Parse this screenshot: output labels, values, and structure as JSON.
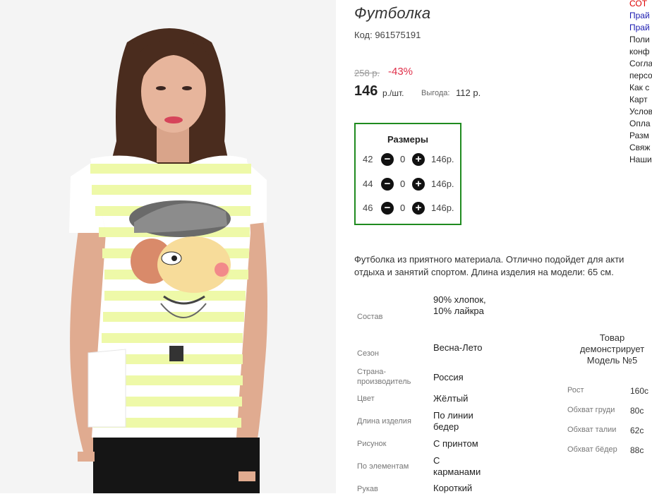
{
  "product": {
    "title": "Футболка",
    "code": "Код: 961575191",
    "old_price": "258 р.",
    "discount": "-43%",
    "price": "146",
    "price_unit": "р./шт.",
    "savings_label": "Выгода:",
    "savings_value": "112 р."
  },
  "sizes": {
    "title": "Размеры",
    "rows": [
      {
        "size": "42",
        "qty": "0",
        "price": "146р."
      },
      {
        "size": "44",
        "qty": "0",
        "price": "146р."
      },
      {
        "size": "46",
        "qty": "0",
        "price": "146р."
      }
    ]
  },
  "description": {
    "line1": "Футболка из приятного материала. Отлично подойдет для акти",
    "line2": "отдыха и занятий спортом. Длина изделия на модели: 65 см."
  },
  "attributes": [
    {
      "label": "Состав",
      "value": "90% хлопок, 10% лайкра"
    },
    {
      "label": "Сезон",
      "value": "Весна-Лето"
    },
    {
      "label": "Страна-производитель",
      "value": "Россия"
    },
    {
      "label": "Цвет",
      "value": "Жёлтый"
    },
    {
      "label": "Длина изделия",
      "value": "По линии бедер"
    },
    {
      "label": "Рисунок",
      "value": "С принтом"
    },
    {
      "label": "По элементам",
      "value": "С карманами"
    },
    {
      "label": "Рукав",
      "value": "Короткий"
    }
  ],
  "model": {
    "title": "Товар демонстрирует Модель №5",
    "measurements": [
      {
        "label": "Рост",
        "value": "160с"
      },
      {
        "label": "Обхват груди",
        "value": "80с"
      },
      {
        "label": "Обхват талии",
        "value": "62с"
      },
      {
        "label": "Обхват бёдер",
        "value": "88с"
      }
    ]
  },
  "right_links": [
    {
      "text": "СОТ",
      "style": "red"
    },
    {
      "text": "Прай",
      "style": "blue"
    },
    {
      "text": "Прай",
      "style": "blue"
    },
    {
      "text": "Поли",
      "style": "plain"
    },
    {
      "text": "конф",
      "style": "plain"
    },
    {
      "text": "Согла",
      "style": "plain"
    },
    {
      "text": "персо",
      "style": "plain"
    },
    {
      "text": "Как с",
      "style": "plain"
    },
    {
      "text": "Карт",
      "style": "plain"
    },
    {
      "text": "Услов",
      "style": "plain"
    },
    {
      "text": "Опла",
      "style": "plain"
    },
    {
      "text": "Разм",
      "style": "plain"
    },
    {
      "text": "Свяж",
      "style": "plain"
    },
    {
      "text": "Наши",
      "style": "plain"
    }
  ],
  "colors": {
    "accent_green": "#1f8b1f",
    "discount_red": "#e0304a",
    "shirt_stripe": "#eef9a8"
  },
  "icons": {
    "minus": "minus-circle-icon",
    "plus": "plus-circle-icon"
  }
}
